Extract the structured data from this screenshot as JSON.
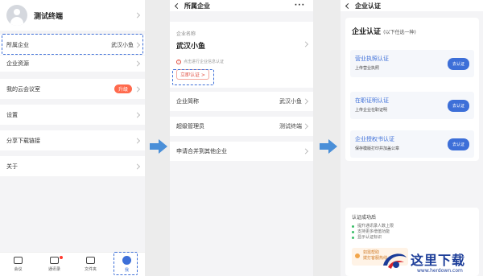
{
  "panel1": {
    "profile_name": "测试终端",
    "menu": [
      {
        "label": "所属企业",
        "value": "武汉小鱼"
      },
      {
        "label": "企业资源"
      },
      {
        "label": "我的云会议室",
        "badge": "升级"
      },
      {
        "label": "设置"
      },
      {
        "label": "分享下载链接"
      },
      {
        "label": "关于"
      }
    ],
    "tabs": [
      {
        "label": "会议",
        "icon": "video-icon"
      },
      {
        "label": "通讯录",
        "icon": "contacts-icon"
      },
      {
        "label": "文件夹",
        "icon": "folder-icon"
      },
      {
        "label": "我",
        "icon": "person-icon"
      }
    ]
  },
  "panel2": {
    "title": "所属企业",
    "more": "···",
    "company_label": "企业名称",
    "company_name": "武汉小鱼",
    "warning": "点击进行企业信息认证",
    "verify_button": "立即认证 >",
    "rows": [
      {
        "label": "企业简称",
        "value": "武汉小鱼"
      },
      {
        "label": "超级管理员",
        "value": "测试终端"
      },
      {
        "label": "申请合并到其他企业"
      }
    ]
  },
  "panel3": {
    "title": "企业认证",
    "heading": "企业认证",
    "heading_note": "(以下任选一种)",
    "options": [
      {
        "title": "营业执照认证",
        "desc": "上传营业执照",
        "button": "去认证"
      },
      {
        "title": "在职证明认证",
        "desc": "上传企业在职证明",
        "button": "去认证"
      },
      {
        "title": "企业授权书认证",
        "desc": "保存模版打印并加盖公章",
        "button": "去认证"
      }
    ],
    "after_title": "认证成功后",
    "after_items": [
      "提升通讯录人数上限",
      "支持更多增值功能",
      "显示认证标识"
    ],
    "tip": [
      "如需帮助",
      "拨打客服热线"
    ]
  },
  "watermark": {
    "text": "这里下载",
    "url": "www.herdown.com"
  },
  "colors": {
    "accent": "#3d6fd8",
    "badge": "#ff6a4d",
    "warning": "#e04b3d",
    "arrow": "#4a8fd8"
  }
}
